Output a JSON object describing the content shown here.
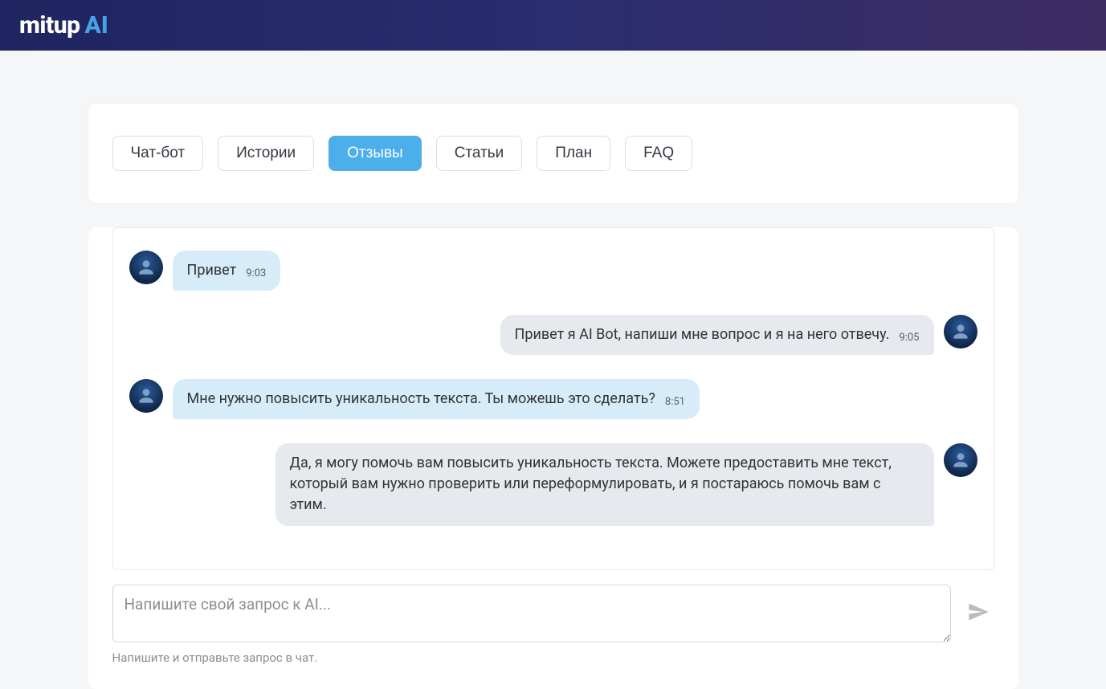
{
  "brand": {
    "main": "mitup",
    "accent": "AI"
  },
  "tabs": [
    {
      "label": "Чат-бот",
      "active": false
    },
    {
      "label": "Истории",
      "active": false
    },
    {
      "label": "Отзывы",
      "active": true
    },
    {
      "label": "Статьи",
      "active": false
    },
    {
      "label": "План",
      "active": false
    },
    {
      "label": "FAQ",
      "active": false
    }
  ],
  "messages": [
    {
      "side": "left",
      "text": "Привет",
      "time": "9:03"
    },
    {
      "side": "right",
      "text": "Привет я AI Bot, напиши мне вопрос и я на него отвечу.",
      "time": "9:05"
    },
    {
      "side": "left",
      "text": "Мне нужно повысить уникальность текста. Ты можешь это сделать?",
      "time": "8:51"
    },
    {
      "side": "right",
      "text": "Да, я могу помочь вам повысить уникальность текста. Можете предоставить мне текст, который вам нужно проверить или переформулировать, и я постараюсь помочь вам с этим.",
      "time": ""
    }
  ],
  "input": {
    "placeholder": "Напишите свой запрос к AI..."
  },
  "hint": "Напишите и отправьте запрос в чат."
}
